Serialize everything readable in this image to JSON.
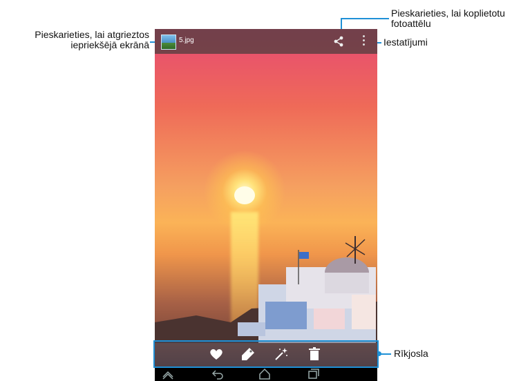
{
  "screen": {
    "file_name": "5.jpg",
    "icons": {
      "app": "gallery-app-icon",
      "share": "share-icon",
      "menu": "overflow-menu-icon",
      "favorite": "heart-icon",
      "tag": "tag-icon",
      "effects": "magic-wand-icon",
      "delete": "trash-icon",
      "home_nav": "home-icon",
      "back_nav": "back-icon",
      "up_nav": "chevron-up-icon",
      "recents_nav": "recent-apps-icon"
    }
  },
  "annotations": {
    "back_line1": "Pieskarieties, lai atgrieztos",
    "back_line2": "iepriekšējā ekrānā",
    "share_line1": "Pieskarieties, lai koplietotu",
    "share_line2": "fotoattēlu",
    "settings": "Iestatījumi",
    "toolbar": "Rīkjosla"
  },
  "colors": {
    "accent": "#1e90d6"
  }
}
